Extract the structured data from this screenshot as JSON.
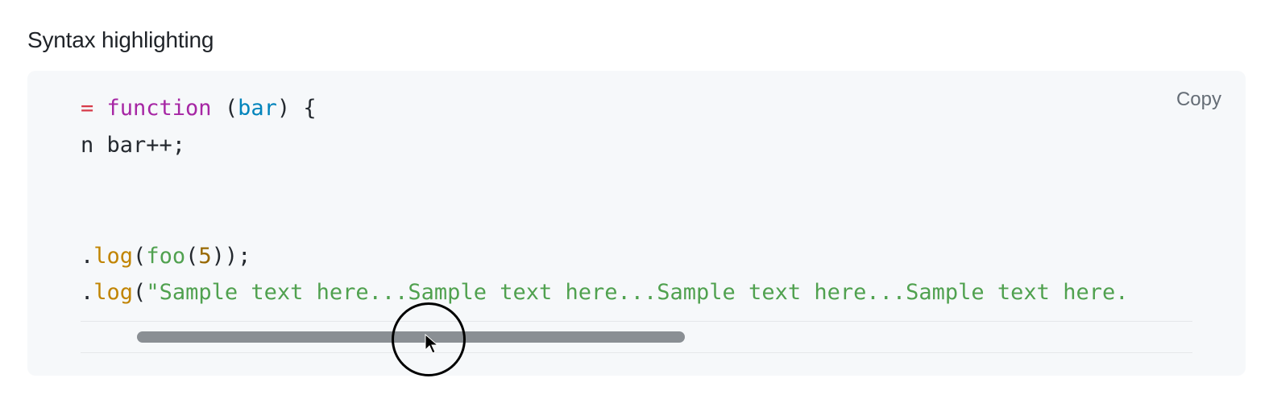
{
  "heading": "Syntax highlighting",
  "copy_label": "Copy",
  "code": {
    "line1": {
      "op": "= ",
      "keyword": "function",
      "paren_open": " (",
      "param": "bar",
      "paren_close": ")",
      "brace": " {"
    },
    "line2": {
      "frag": "n ",
      "text": "bar++;"
    },
    "line3": {
      "dot": ".",
      "method": "log",
      "open": "(",
      "call": "foo",
      "open2": "(",
      "num": "5",
      "close": "));"
    },
    "line4": {
      "dot": ".",
      "method": "log",
      "open": "(",
      "string": "\"Sample text here...Sample text here...Sample text here...Sample text here."
    }
  },
  "colors": {
    "op": "#d73a49",
    "keyword": "#a626a4",
    "param": "#0184bc",
    "method": "#c18401",
    "call": "#50a14f",
    "number": "#986801",
    "string": "#50a14f"
  }
}
